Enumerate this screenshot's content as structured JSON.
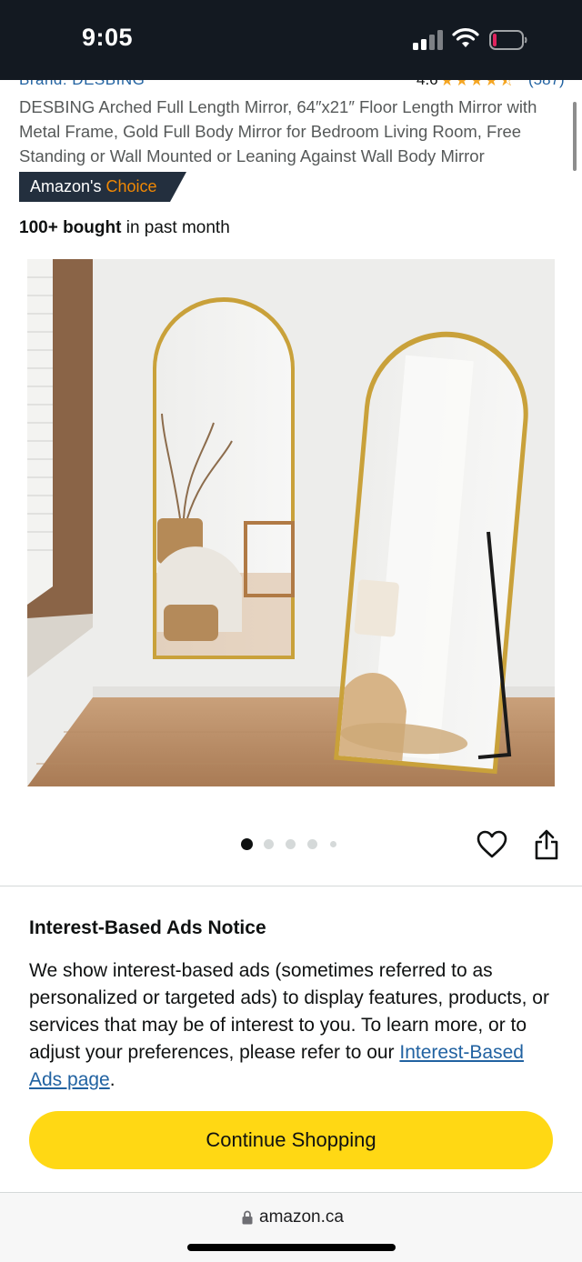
{
  "status_bar": {
    "time": "9:05",
    "icons": [
      "cellular-signal-icon",
      "wifi-icon",
      "battery-icon"
    ]
  },
  "product": {
    "brand": "Brand: DESBING",
    "rating_value": "4.6",
    "rating_stars": 4.5,
    "rating_count": "(587)",
    "title": "DESBING Arched Full Length Mirror, 64″x21″ Floor Length Mirror with Metal Frame, Gold Full Body Mirror for Bedroom Living Room, Free Standing or Wall Mounted or Leaning Against Wall Body Mirror",
    "badge": {
      "prefix": "Amazon's",
      "accent": "Choice"
    },
    "bought": {
      "bold": "100+ bought",
      "rest": " in past month"
    }
  },
  "carousel": {
    "total": 5,
    "active_index": 0,
    "actions": [
      "heart-icon",
      "share-icon"
    ]
  },
  "ads_notice": {
    "title": "Interest-Based Ads Notice",
    "body": "We show interest-based ads (sometimes referred to as personalized or targeted ads) to display features, products, or services that may be of interest to you. To learn more, or to adjust your preferences, please refer to our ",
    "link_text": "Interest-Based Ads page",
    "body_end": ".",
    "button_label": "Continue Shopping"
  },
  "browser": {
    "url": "amazon.ca"
  },
  "colors": {
    "header_bg": "#131921",
    "link": "#2162a1",
    "star": "#f5a623",
    "badge_bg": "#232f3e",
    "badge_accent": "#f08804",
    "button": "#ffd814",
    "gold_frame": "#c9a13a"
  }
}
